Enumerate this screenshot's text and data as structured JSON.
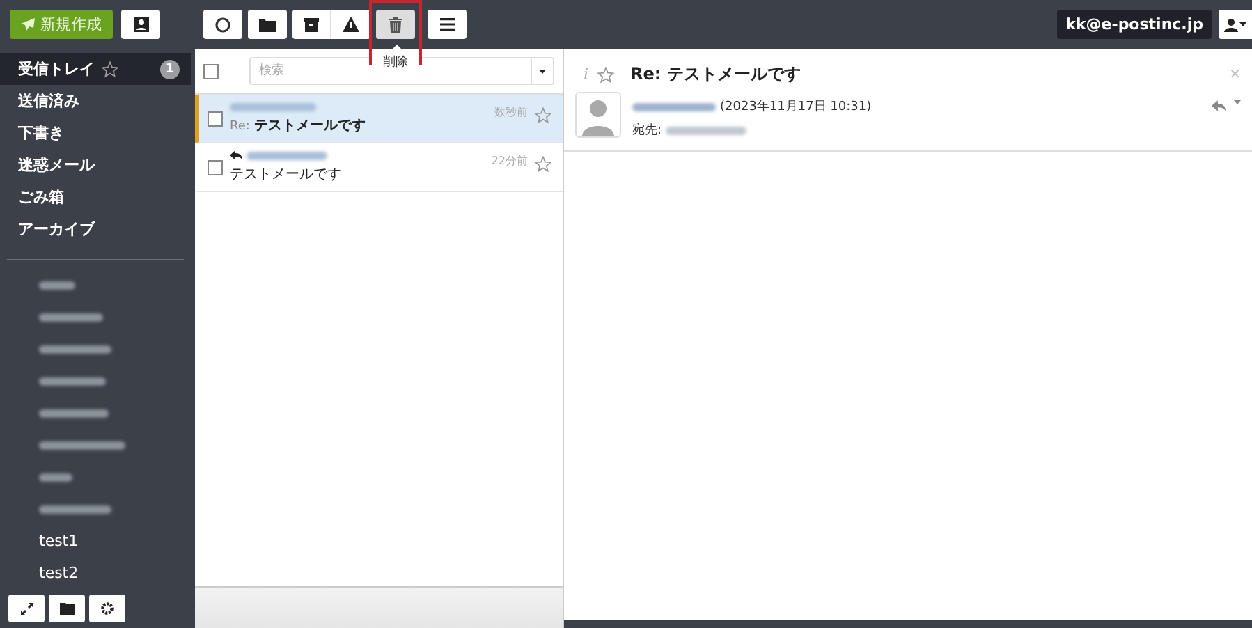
{
  "topbar": {
    "compose": {
      "label": "新規作成"
    },
    "toolbar": [
      {
        "kind": "refresh",
        "selected": false
      },
      {
        "kind": "folder",
        "selected": false
      },
      {
        "kind": "archive",
        "selected": false
      },
      {
        "kind": "warning",
        "selected": false
      },
      {
        "kind": "trash",
        "selected": true,
        "highlighted": true
      },
      {
        "kind": "menu",
        "selected": false
      }
    ],
    "tooltip": "削除",
    "account": "kk@e-postinc.jp"
  },
  "sidebar": {
    "folders": [
      {
        "kind": "named",
        "label": "受信トレイ",
        "selected": true,
        "starred": false,
        "badge": "1"
      },
      {
        "kind": "named",
        "label": "送信済み",
        "selected": false
      },
      {
        "kind": "named",
        "label": "下書き",
        "selected": false
      },
      {
        "kind": "named",
        "label": "迷惑メール",
        "selected": false
      },
      {
        "kind": "named",
        "label": "ごみ箱",
        "selected": false
      },
      {
        "kind": "named",
        "label": "アーカイブ",
        "selected": false
      },
      {
        "kind": "divider"
      },
      {
        "kind": "blurred",
        "selected": false
      },
      {
        "kind": "blurred",
        "selected": false
      },
      {
        "kind": "blurred",
        "selected": false
      },
      {
        "kind": "blurred",
        "selected": false
      },
      {
        "kind": "blurred",
        "selected": false
      },
      {
        "kind": "blurred",
        "selected": false
      },
      {
        "kind": "blurred",
        "selected": false
      },
      {
        "kind": "blurred",
        "selected": false
      },
      {
        "kind": "named",
        "label": "test1",
        "selected": false
      },
      {
        "kind": "named",
        "label": "test2",
        "selected": false
      }
    ]
  },
  "mail_list": {
    "search": {
      "placeholder": "検索"
    },
    "select_all": {
      "checked": false
    },
    "messages": [
      {
        "prefix": "Re:",
        "subject": "テストメールです",
        "time": "数秒前",
        "selected": true,
        "checked": false,
        "starred": false,
        "replied": false
      },
      {
        "subject": "テストメールです",
        "time": "22分前",
        "selected": false,
        "checked": false,
        "starred": false,
        "replied": true
      }
    ]
  },
  "reader": {
    "info": "i",
    "close": "×",
    "subject": "Re: テストメールです",
    "starred": false,
    "date": "(2023年11月17日 10:31)",
    "to_label": "宛先:"
  }
}
